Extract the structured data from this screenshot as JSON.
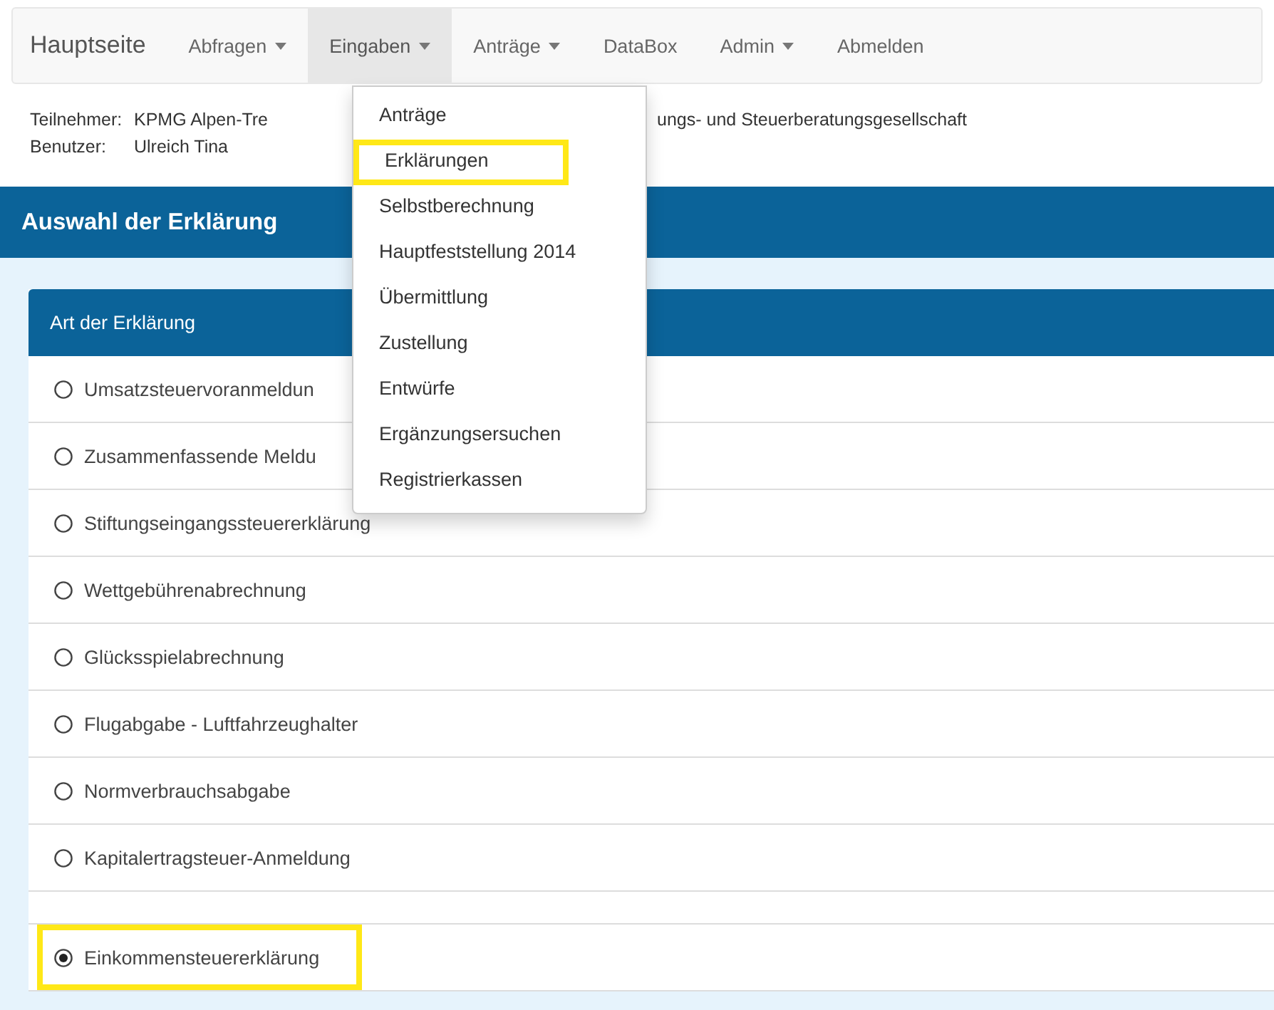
{
  "navbar": {
    "brand": "Hauptseite",
    "items": [
      {
        "label": "Abfragen",
        "dropdown": true,
        "selected": false
      },
      {
        "label": "Eingaben",
        "dropdown": true,
        "selected": true
      },
      {
        "label": "Anträge",
        "dropdown": true,
        "selected": false
      },
      {
        "label": "DataBox",
        "dropdown": false,
        "selected": false
      },
      {
        "label": "Admin",
        "dropdown": true,
        "selected": false
      },
      {
        "label": "Abmelden",
        "dropdown": false,
        "selected": false
      }
    ]
  },
  "dropdown_menu": [
    {
      "label": "Anträge",
      "highlighted": false
    },
    {
      "label": "Erklärungen",
      "highlighted": true
    },
    {
      "label": "Selbstberechnung",
      "highlighted": false
    },
    {
      "label": "Hauptfeststellung 2014",
      "highlighted": false
    },
    {
      "label": "Übermittlung",
      "highlighted": false
    },
    {
      "label": "Zustellung",
      "highlighted": false
    },
    {
      "label": "Entwürfe",
      "highlighted": false
    },
    {
      "label": "Ergänzungsersuchen",
      "highlighted": false
    },
    {
      "label": "Registrierkassen",
      "highlighted": false
    }
  ],
  "info": [
    {
      "label": "Teilnehmer:",
      "value": "KPMG Alpen-Tre",
      "value_after_menu": "ungs- und Steuerberatungsgesellschaft"
    },
    {
      "label": "Benutzer:",
      "value": "Ulreich Tina"
    }
  ],
  "page_title": "Auswahl der Erklärung",
  "panel": {
    "heading": "Art der Erklärung",
    "options": [
      {
        "kind": "radio",
        "label": "Umsatzsteuervoranmeldun",
        "selected": false,
        "highlighted": false
      },
      {
        "kind": "radio",
        "label": "Zusammenfassende Meldu",
        "selected": false,
        "highlighted": false
      },
      {
        "kind": "radio",
        "label": "Stiftungseingangssteuererklärung",
        "selected": false,
        "highlighted": false
      },
      {
        "kind": "radio",
        "label": "Wettgebührenabrechnung",
        "selected": false,
        "highlighted": false
      },
      {
        "kind": "radio",
        "label": "Glücksspielabrechnung",
        "selected": false,
        "highlighted": false
      },
      {
        "kind": "radio",
        "label": "Flugabgabe - Luftfahrzeughalter",
        "selected": false,
        "highlighted": false
      },
      {
        "kind": "radio",
        "label": "Normverbrauchsabgabe",
        "selected": false,
        "highlighted": false
      },
      {
        "kind": "radio",
        "label": "Kapitalertragsteuer-Anmeldung",
        "selected": false,
        "highlighted": false
      },
      {
        "kind": "empty"
      },
      {
        "kind": "radio",
        "label": "Einkommensteuererklärung",
        "selected": true,
        "highlighted": true
      }
    ]
  }
}
